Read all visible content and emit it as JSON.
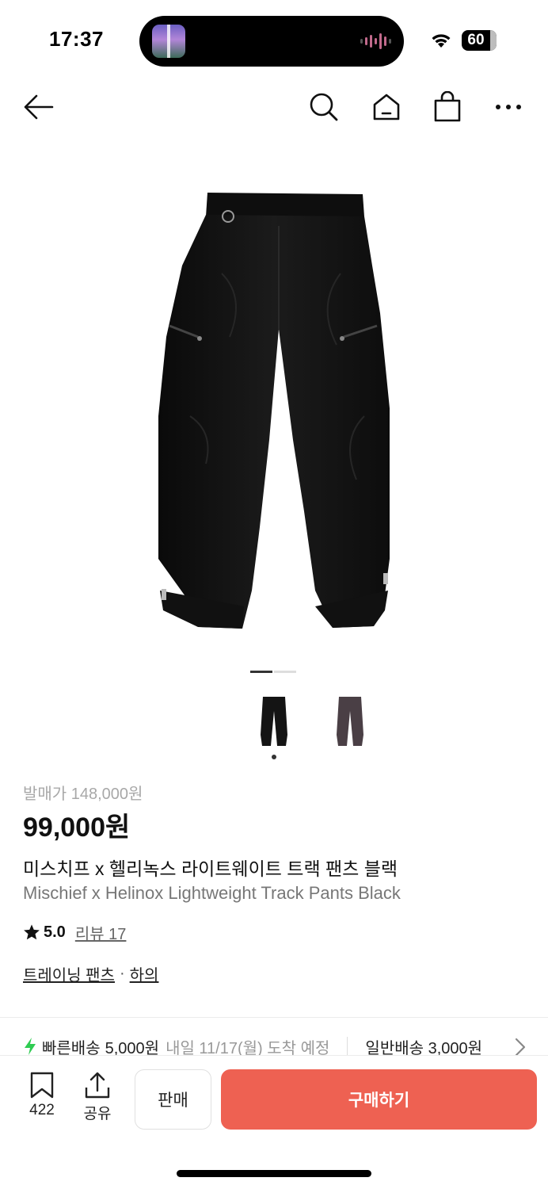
{
  "status_bar": {
    "time": "17:37",
    "battery": "60",
    "icons": [
      "wifi-icon",
      "battery-icon",
      "now-playing-waveform"
    ]
  },
  "nav": {
    "icons": [
      "back-arrow-icon",
      "search-icon",
      "home-icon",
      "shopping-bag-icon",
      "more-icon"
    ]
  },
  "gallery": {
    "page_count": 2,
    "current_page": 1,
    "thumbnails": [
      {
        "color": "#161616",
        "label": "black"
      },
      {
        "color": "#4a3f45",
        "label": "charcoal"
      }
    ]
  },
  "product": {
    "release_price": "발매가 148,000원",
    "price": "99,000원",
    "name_ko": "미스치프 x 헬리녹스 라이트웨이트 트랙 팬츠 블랙",
    "name_en": "Mischief x Helinox Lightweight Track Pants Black",
    "rating": "5.0",
    "review_label": "리뷰 17",
    "categories": [
      "트레이닝 팬츠",
      "하의"
    ],
    "category_separator": "·"
  },
  "shipping": {
    "fast_label": "빠른배송",
    "fast_price": "5,000원",
    "fast_eta": "내일 11/17(월) 도착 예정",
    "normal_label": "일반배송 3,000원"
  },
  "bottom_bar": {
    "bookmark_count": "422",
    "share_label": "공유",
    "sell_label": "판매",
    "buy_label": "구매하기"
  },
  "colors": {
    "buy_button": "#ee6152",
    "fast_shipping_icon": "#2fcc52",
    "muted_text": "#999999"
  }
}
